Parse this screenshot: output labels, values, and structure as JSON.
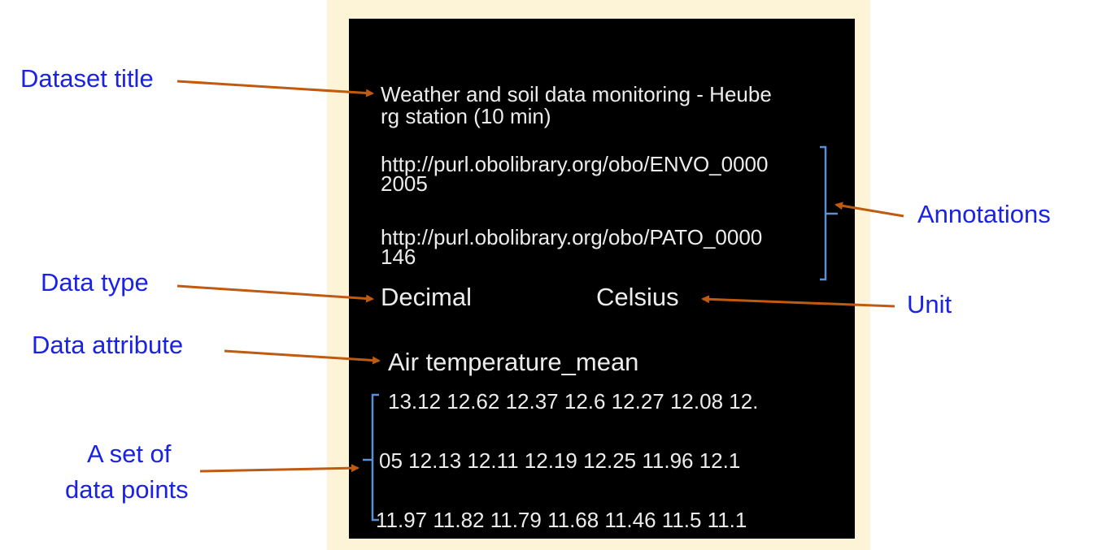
{
  "panel": {
    "title_line1": "Weather and soil data monitoring - Heube",
    "title_line2": "rg station (10 min)",
    "annotation1_line1": "http://purl.obolibrary.org/obo/ENVO_0000",
    "annotation1_line2": "2005",
    "annotation2_line1": "http://purl.obolibrary.org/obo/PATO_0000",
    "annotation2_line2": "146",
    "data_type": "Decimal",
    "unit": "Celsius",
    "attribute": "Air temperature_mean",
    "data_row1": "13.12  12.62  12.37  12.6  12.27  12.08  12.",
    "data_row2": "05  12.13  12.11  12.19  12.25  11.96  12.1",
    "data_row3": "11.97  11.82  11.79  11.68  11.46  11.5  11.1"
  },
  "labels": {
    "dataset_title": "Dataset title",
    "annotations": "Annotations",
    "data_type": "Data type",
    "unit": "Unit",
    "data_attribute": "Data attribute",
    "data_points_line1": "A set of",
    "data_points_line2": "data points"
  },
  "colors": {
    "label_text": "#1a22e6",
    "arrow": "#c05a10",
    "bracket": "#5b8fd6",
    "frame": "#fdf3d6",
    "panel": "#000000",
    "panel_text": "#ececec"
  }
}
